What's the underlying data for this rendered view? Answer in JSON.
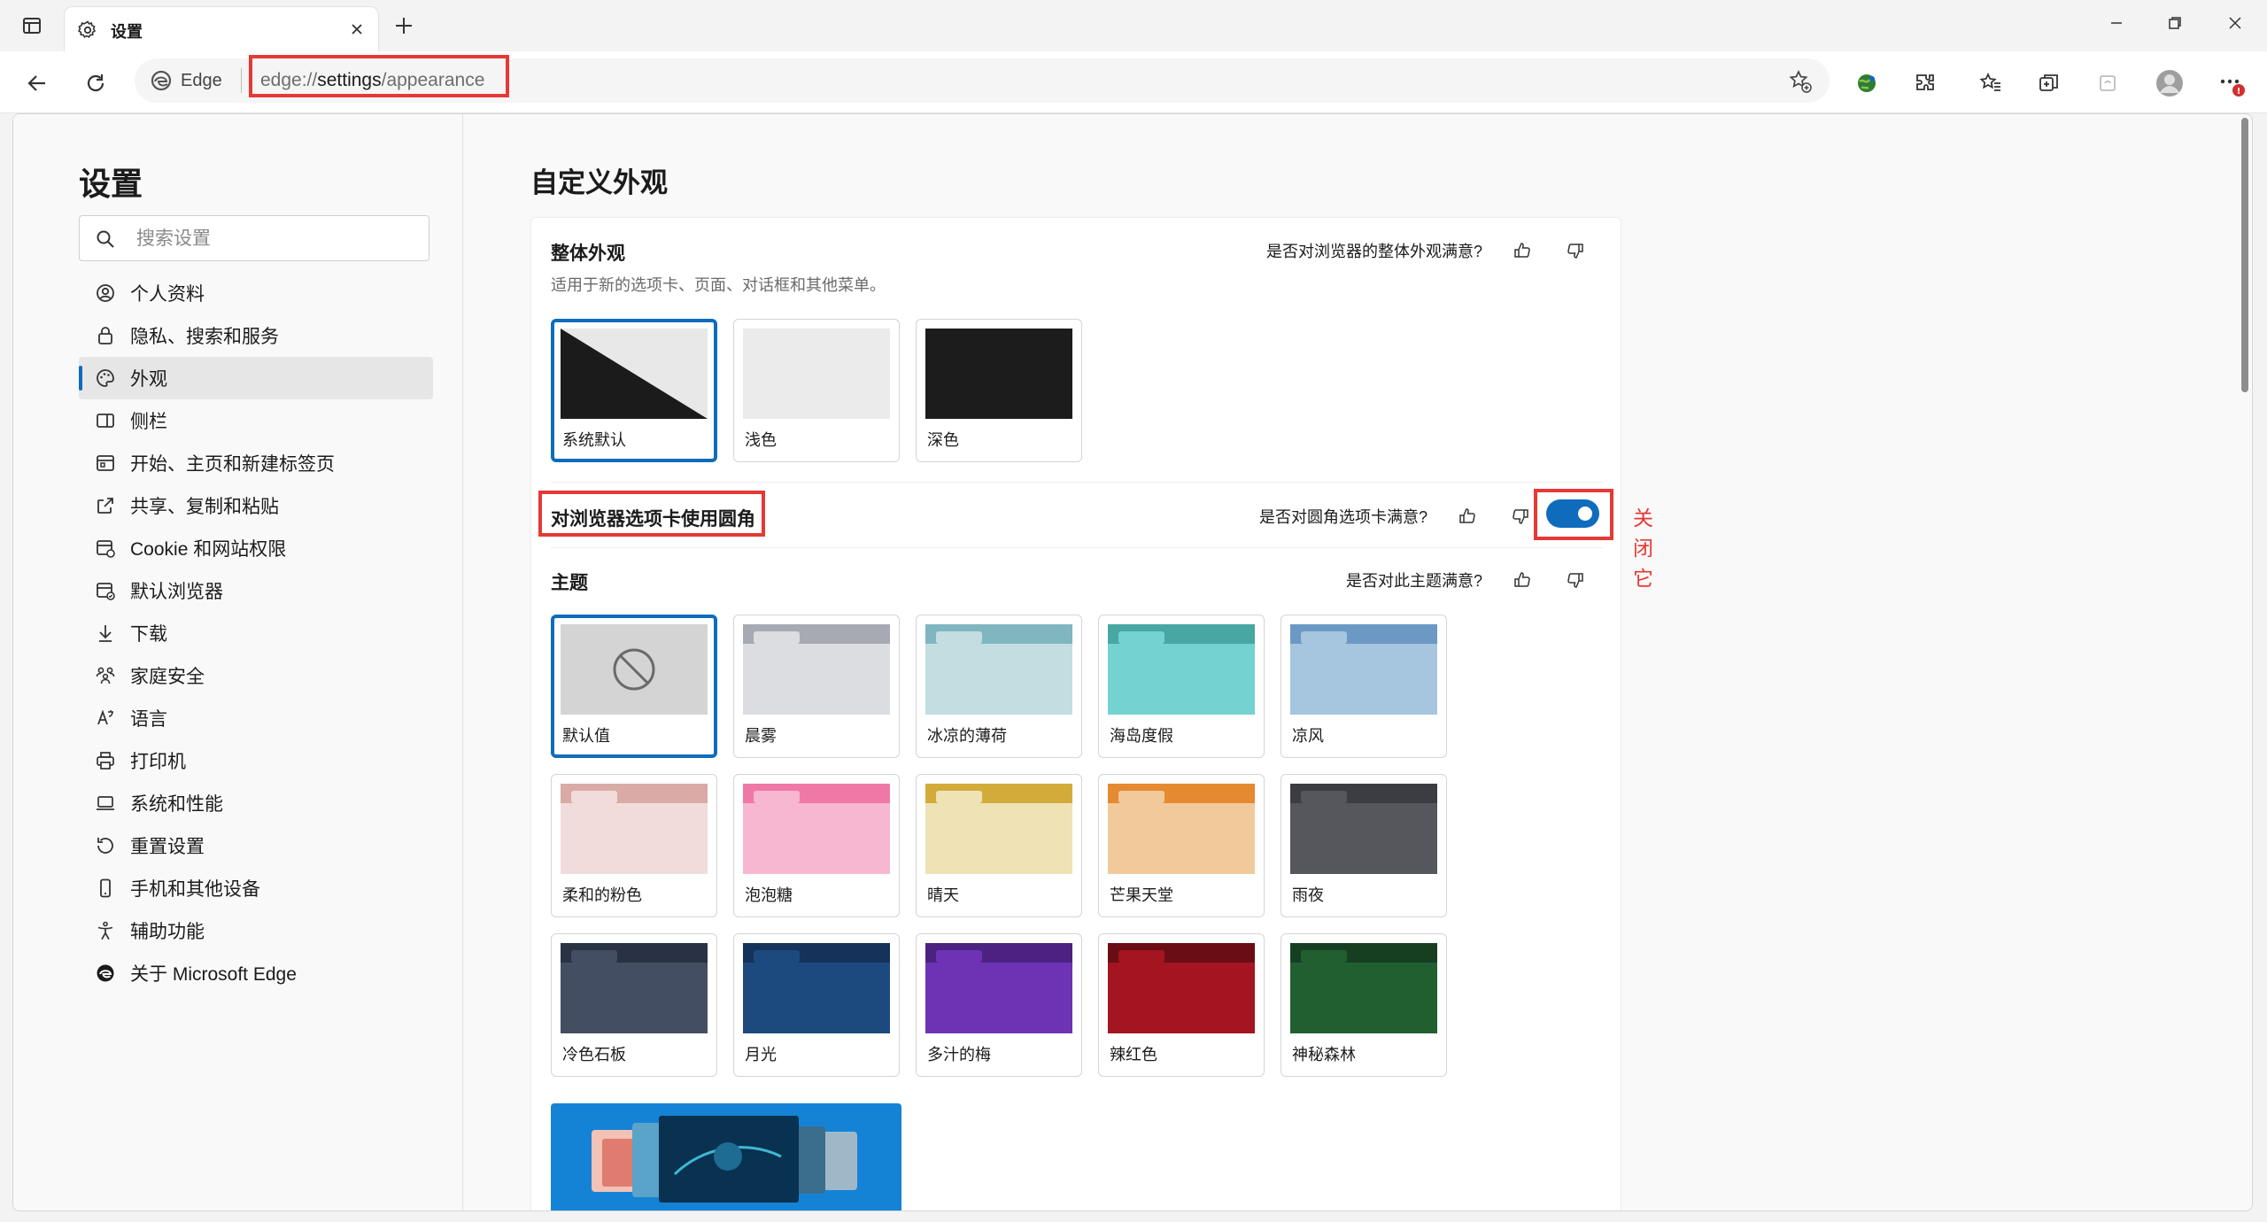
{
  "browser": {
    "tab": {
      "title": "设置"
    },
    "address": {
      "site_label": "Edge",
      "url_scheme": "edge://",
      "url_host": "settings",
      "url_path": "/appearance"
    }
  },
  "sidebar": {
    "title": "设置",
    "search_placeholder": "搜索设置",
    "items": [
      {
        "label": "个人资料",
        "icon": "profile-icon"
      },
      {
        "label": "隐私、搜索和服务",
        "icon": "lock-icon"
      },
      {
        "label": "外观",
        "icon": "palette-icon",
        "active": true
      },
      {
        "label": "侧栏",
        "icon": "sidebar-icon"
      },
      {
        "label": "开始、主页和新建标签页",
        "icon": "home-tab-icon"
      },
      {
        "label": "共享、复制和粘贴",
        "icon": "share-icon"
      },
      {
        "label": "Cookie 和网站权限",
        "icon": "cookie-icon"
      },
      {
        "label": "默认浏览器",
        "icon": "browser-icon"
      },
      {
        "label": "下载",
        "icon": "download-icon"
      },
      {
        "label": "家庭安全",
        "icon": "family-icon"
      },
      {
        "label": "语言",
        "icon": "language-icon"
      },
      {
        "label": "打印机",
        "icon": "printer-icon"
      },
      {
        "label": "系统和性能",
        "icon": "laptop-icon"
      },
      {
        "label": "重置设置",
        "icon": "reset-icon"
      },
      {
        "label": "手机和其他设备",
        "icon": "phone-icon"
      },
      {
        "label": "辅助功能",
        "icon": "accessibility-icon"
      },
      {
        "label": "关于 Microsoft Edge",
        "icon": "edge-logo-icon"
      }
    ]
  },
  "main": {
    "title": "自定义外观",
    "overall": {
      "title": "整体外观",
      "description": "适用于新的选项卡、页面、对话框和其他菜单。",
      "feedback": "是否对浏览器的整体外观满意?",
      "options": [
        {
          "label": "系统默认",
          "selected": true
        },
        {
          "label": "浅色"
        },
        {
          "label": "深色"
        }
      ]
    },
    "rounded_tabs": {
      "title": "对浏览器选项卡使用圆角",
      "feedback": "是否对圆角选项卡满意?",
      "enabled": true,
      "annotation": "关闭它"
    },
    "theme": {
      "title": "主题",
      "feedback": "是否对此主题满意?",
      "items": [
        {
          "label": "默认值",
          "selected": true,
          "tab": "#c8c8c8",
          "body": "#d4d4d4"
        },
        {
          "label": "晨雾",
          "tab": "#a8aab3",
          "body": "#dcdde1"
        },
        {
          "label": "冰凉的薄荷",
          "tab": "#7fb6c0",
          "body": "#c4dde1"
        },
        {
          "label": "海岛度假",
          "tab": "#48a6a3",
          "body": "#74d2d0"
        },
        {
          "label": "凉风",
          "tab": "#6b99c3",
          "body": "#a6c5de"
        },
        {
          "label": "柔和的粉色",
          "tab": "#d9aaa6",
          "body": "#f1dcdb"
        },
        {
          "label": "泡泡糖",
          "tab": "#f078a7",
          "body": "#f7b7d0"
        },
        {
          "label": "晴天",
          "tab": "#d2ab3b",
          "body": "#efe2b4"
        },
        {
          "label": "芒果天堂",
          "tab": "#e58a31",
          "body": "#f2c99b"
        },
        {
          "label": "雨夜",
          "tab": "#3c3d42",
          "body": "#56575c"
        },
        {
          "label": "冷色石板",
          "tab": "#283244",
          "body": "#434e62"
        },
        {
          "label": "月光",
          "tab": "#14325a",
          "body": "#1d4a7e"
        },
        {
          "label": "多汁的梅",
          "tab": "#4c2280",
          "body": "#6d33b4"
        },
        {
          "label": "辣红色",
          "tab": "#6b0d14",
          "body": "#a41421"
        },
        {
          "label": "神秘森林",
          "tab": "#163f22",
          "body": "#215f30"
        }
      ]
    }
  }
}
